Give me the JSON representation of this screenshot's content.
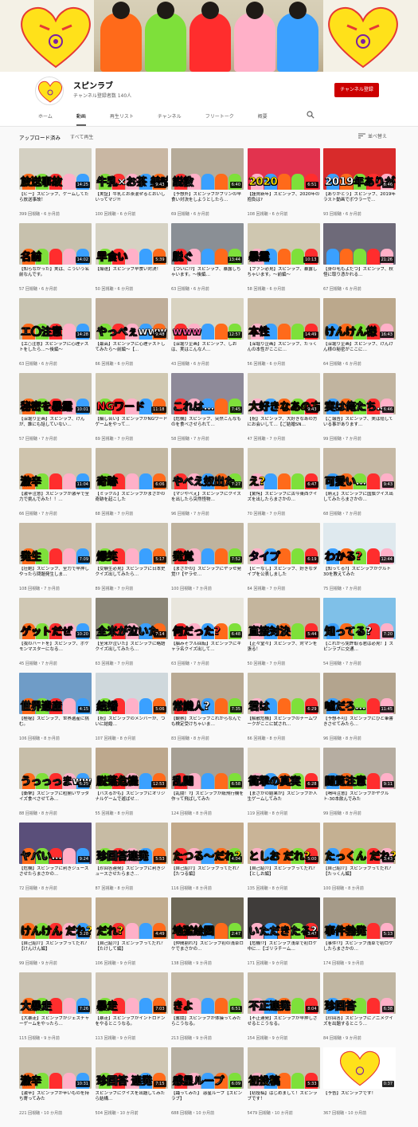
{
  "channel": {
    "name": "スピンラブ",
    "subscribers": "チャンネル登録者数 140人",
    "subscribe_label": "チャンネル登録"
  },
  "tabs": [
    {
      "label": "ホーム"
    },
    {
      "label": "動画"
    },
    {
      "label": "再生リスト"
    },
    {
      "label": "チャンネル"
    },
    {
      "label": "フリートーク"
    },
    {
      "label": "概要"
    }
  ],
  "filter": {
    "label": "アップロード済み",
    "play_all": "すべて再生",
    "sort": "並べ替え"
  },
  "colors": {
    "accent": "#cc0000",
    "heart": "#ffe11a"
  },
  "videos": [
    {
      "cap": "放送事故",
      "capcolor": "#ffd200",
      "bg": "#d4d0c2",
      "dur": "14:25",
      "title": "【ビー】スピンラブ、ゲームしてたら放送事故！",
      "meta": "399 回視聴・6 か月前"
    },
    {
      "cap": "牛乳×お茶 美味しいの?",
      "capcolor": "#ffffff",
      "bg": "#c9b7a3",
      "dur": "9:43",
      "title": "【実証】牛乳とお茶混ぜるとおいしいってマジ?!",
      "meta": "100 回視聴・6 か月前"
    },
    {
      "cap": "説教",
      "capcolor": "#ffffff",
      "bg": "#b6ab99",
      "dur": "6:40",
      "title": "【予想外】スピンラブがプリンの早食い対決をしようとしたら…",
      "meta": "69 回視聴・6 か月前"
    },
    {
      "cap": "2020",
      "capcolor": "#ffe600",
      "bg": "#e2334e",
      "dur": "6:51",
      "title": "【謹賀新年】スピンラブ、2020年の抱負は?",
      "meta": "108 回視聴・6 か月前"
    },
    {
      "cap": "2019年ありがとう",
      "capcolor": "#ffffff",
      "bg": "#d82b2b",
      "dur": "6:46",
      "title": "【ありがとう】スピンラブ、2019年ラスト動画でボウラーで…",
      "meta": "93 回視聴・6 か月前"
    },
    {
      "cap": "名前",
      "capcolor": "#ff2222",
      "bg": "#c7c1ad",
      "dur": "14:02",
      "title": "【知らなかった】実は、こういう名前なんです。",
      "meta": "57 回視聴・6 か月前"
    },
    {
      "cap": "早食い",
      "capcolor": "#ff2222",
      "bg": "#d6d2c3",
      "dur": "5:39",
      "title": "【爆速】スピンラブ早食い対決！",
      "meta": "50 回視聴・6 か月前"
    },
    {
      "cap": "脱ぐ",
      "capcolor": "#ffffff",
      "bg": "#8a8f95",
      "dur": "13:44",
      "title": "【ついに!?】スピンラブ、暴露しちゃいます。〜後編…",
      "meta": "63 回視聴・6 か月前"
    },
    {
      "cap": "暴露",
      "capcolor": "#ff2222",
      "bg": "#cfc7b0",
      "dur": "10:13",
      "title": "【ファン必見】スピンラブ、暴露しちゃいます。〜前編〜",
      "meta": "58 回視聴・6 か月前"
    },
    {
      "cap": "",
      "capcolor": "#ffffff",
      "bg": "#6e6a79",
      "dur": "21:26",
      "title": "【身の毛もよだつ】スピンラブ、秋怪に取り憑かれる…",
      "meta": "67 回視聴・6 か月前"
    },
    {
      "cap": "エ〇注意",
      "capcolor": "#ffffff",
      "bg": "#c8c3b0",
      "dur": "14:28",
      "title": "【エ○注意】スピンラブに心理テストをしたら…〜後編〜",
      "meta": "63 回視聴・6 か月前"
    },
    {
      "cap": "やっぺぇwww",
      "capcolor": "#ffffff",
      "bg": "#bfae9a",
      "dur": "9:48",
      "title": "【最高】スピンラブに心理テストしてみたら〜前編〜【…",
      "meta": "66 回視聴・6 か月前"
    },
    {
      "cap": "www",
      "capcolor": "#ff5ea8",
      "bg": "#d9d3c1",
      "dur": "12:57",
      "title": "【深堀り企画】スピンラブ、しおは、実はこんな人…",
      "meta": "43 回視聴・6 か月前"
    },
    {
      "cap": "本性",
      "capcolor": "#ff2222",
      "bg": "#c7b8a0",
      "dur": "14:49",
      "title": "【深堀り企画】スピンラブ、たっくんの本性がここに…",
      "meta": "56 回視聴・6 か月前"
    },
    {
      "cap": "けんけん様",
      "capcolor": "#ffd200",
      "bg": "#bba88c",
      "dur": "16:43",
      "title": "【深堀り企画】スピンラブ、けんけん様の秘密がここに…",
      "meta": "64 回視聴・6 か月前"
    },
    {
      "cap": "秘密を暴露",
      "capcolor": "#ff2222",
      "bg": "#c9c2af",
      "dur": "10:01",
      "title": "【深堀り企画】スピンラブ、けんが、誰にも話していない…",
      "meta": "57 回視聴・7 か月前"
    },
    {
      "cap": "NGワード",
      "capcolor": "#ff2222",
      "bg": "#d0c8b1",
      "dur": "11:18",
      "title": "【騙し合い】スピンラブがNGワードゲームをやって…",
      "meta": "69 回視聴・7 か月前"
    },
    {
      "cap": "これは…",
      "capcolor": "#ffffff",
      "bg": "#8e8a99",
      "dur": "7:45",
      "title": "【危機】スピンラブ、突然こんなものを食べさせられて…",
      "meta": "58 回視聴・7 か月前"
    },
    {
      "cap": "大好きなあの方",
      "capcolor": "#ffd200",
      "bg": "#d6cfbd",
      "dur": "9:43",
      "title": "【祝】スピンラブ、大好きなあの方にお会いして…【ご結婚SN…",
      "meta": "47 回視聴・7 か月前"
    },
    {
      "cap": "実は俺たち…",
      "capcolor": "#ffffff",
      "bg": "#c1b49f",
      "dur": "6:46",
      "title": "【ご報告】スピンラブ、実は隠している事があります…",
      "meta": "99 回視聴・7 か月前"
    },
    {
      "cap": "激辛",
      "capcolor": "#ffd200",
      "bg": "#cfc4ad",
      "dur": "11:04",
      "title": "【激辛注意】スピンラブが激辛で全力で挑んでみた！！…",
      "meta": "66 回視聴・7 か月前"
    },
    {
      "cap": "奇跡",
      "capcolor": "#ffd200",
      "bg": "#c4b9a3",
      "dur": "6:06",
      "title": "【ミラクル】スピンラブがまさかの奇跡を起こした",
      "meta": "68 回視聴・7 か月前"
    },
    {
      "cap": "やべえ奴出た",
      "capcolor": "#ffffff",
      "bg": "#b7ac98",
      "dur": "7:27",
      "title": "【マジやべえ】スピンラブにクイズを出したら突然怪物…",
      "meta": "96 回視聴・7 か月前"
    },
    {
      "cap": "え?",
      "capcolor": "#ffd200",
      "bg": "#d3ccb9",
      "dur": "6:47",
      "title": "【驚愕】スピンラブに古今東西クイズを出したらまさかの…",
      "meta": "70 回視聴・7 か月前"
    },
    {
      "cap": "可愛い…",
      "capcolor": "#ffffff",
      "bg": "#c6b9a5",
      "dur": "9:43",
      "title": "【萌え】スピンラブに国旗クイズ出してみたらまさかの…",
      "meta": "68 回視聴・7 か月前"
    },
    {
      "cap": "発生",
      "capcolor": "#ffd200",
      "bg": "#c9bda8",
      "dur": "7:09",
      "title": "【壮絶】スピンラブ、全力で早押しやったら問題発生しま…",
      "meta": "108 回視聴・7 か月前"
    },
    {
      "cap": "爆笑",
      "capcolor": "#ffd200",
      "bg": "#cbc3b0",
      "dur": "5:17",
      "title": "【受験生必見】スピンラブに日本史クイズ出してみたら…",
      "meta": "89 回視聴・7 か月前"
    },
    {
      "cap": "発覚",
      "capcolor": "#ffd200",
      "bg": "#bfb39e",
      "dur": "7:52",
      "title": "【まさかの】スピンラブにヤラセ発覚!?【ヤラセ…",
      "meta": "100 回視聴・7 か月前"
    },
    {
      "cap": "タイプ",
      "capcolor": "#a855f7",
      "bg": "#d2cab7",
      "dur": "6:19",
      "title": "【ビーなし】スピンラブ、好きなタイプを公表しました",
      "meta": "64 回視聴・7 か月前"
    },
    {
      "cap": "わかる?",
      "capcolor": "#ff2222",
      "bg": "#dfe9ee",
      "dur": "12:44",
      "title": "【知ってる?】スピンラブがクルト30を教えてみた",
      "meta": "75 回視聴・7 か月前"
    },
    {
      "cap": "ゲットだぜ",
      "capcolor": "#ff2222",
      "bg": "#d0c8b4",
      "dur": "10:20",
      "title": "【我のハートを】スピンラブ、ポケモンマスターになる…",
      "meta": "45 回視聴・7 か月前"
    },
    {
      "cap": "全米が泣いた",
      "capcolor": "#ffffff",
      "bg": "#8b8677",
      "dur": "7:14",
      "title": "【全米が泣いた】スピンラブに略語クイズ出してみたら…",
      "meta": "63 回視聴・7 か月前"
    },
    {
      "cap": "何だった?",
      "capcolor": "#ff2222",
      "bg": "#e9e6dd",
      "dur": "6:48",
      "title": "【脳みそフル回転】スピンラブにキャラ名クイズ出して…",
      "meta": "63 回視聴・7 か月前"
    },
    {
      "cap": "直接対決",
      "capcolor": "#ffffff",
      "bg": "#c4b59d",
      "dur": "5:44",
      "title": "【正々堂々】スピンラブ、対マンを張る！",
      "meta": "50 回視聴・7 か月前"
    },
    {
      "cap": "知ってる?",
      "capcolor": "#ffffff",
      "bg": "#7fc0e8",
      "dur": "7:20",
      "title": "【これから免許取る君は必見！】スピンラブに交通…",
      "meta": "54 回視聴・7 か月前"
    },
    {
      "cap": "世界遺産",
      "capcolor": "#ffffff",
      "bg": "#6f9cc7",
      "dur": "4:15",
      "title": "【極秘】スピンラブ、世界遺産に挑む。",
      "meta": "106 回視聴・8 か月前"
    },
    {
      "cap": "結婚",
      "capcolor": "#ffffff",
      "bg": "#cfd8dc",
      "dur": "5:06",
      "title": "【祝】スピンラブのメンバーが、ついに結婚…",
      "meta": "107 回視聴・8 か月前"
    },
    {
      "cap": "常識人?",
      "capcolor": "#ffffff",
      "bg": "#b9aa94",
      "dur": "7:35",
      "title": "【観察】スピンラブこれからなんでも検定受けちゃいま…",
      "meta": "83 回視聴・8 か月前"
    },
    {
      "cap": "君は",
      "capcolor": "#ffffff",
      "bg": "#c9c0ab",
      "dur": "6:29",
      "title": "【解散危機】スピンラブのチームワークがここに試され…",
      "meta": "66 回視聴・8 か月前"
    },
    {
      "cap": "嘘だろ…",
      "capcolor": "#ffffff",
      "bg": "#b3a48e",
      "dur": "11:45",
      "title": "【予想不可】スピンラブにひと筆書きさせてみたら…",
      "meta": "96 回視聴・8 か月前"
    },
    {
      "cap": "うっっっまwww",
      "capcolor": "#ffffff",
      "bg": "#c7bea9",
      "dur": "6:25",
      "title": "【衝撃】スピンラブに粒揃いサラダイズ食べさせてみ…",
      "meta": "88 回視聴・8 か月前"
    },
    {
      "cap": "脱落危機",
      "capcolor": "#ffd200",
      "bg": "#bda88d",
      "dur": "12:53",
      "title": "【バズるかも】スピンラブにオリジナルゲームで遊ばせ…",
      "meta": "55 回視聴・8 か月前"
    },
    {
      "cap": "乱闘",
      "capcolor": "#ffffff",
      "bg": "#a7a094",
      "dur": "6:58",
      "title": "【乱闘！?】スピンラブが紙飛行機を作って飛ばしてみた",
      "meta": "124 回視聴・8 か月前"
    },
    {
      "cap": "衝撃の真実",
      "capcolor": "#ffffff",
      "bg": "#ddd6c6",
      "dur": "6:28",
      "title": "【まさかの結果が】スピンラブが人生ゲームしてみた",
      "meta": "119 回視聴・8 か月前"
    },
    {
      "cap": "閲覧注意",
      "capcolor": "#ffffff",
      "bg": "#b6ada1",
      "dur": "9:11",
      "title": "【喝叫注意】スピンラブがヤクルト-30本飲んでみた",
      "meta": "99 回視聴・8 か月前"
    },
    {
      "cap": "ヤバい…",
      "capcolor": "#ffffff",
      "bg": "#5a4f7a",
      "dur": "9:24",
      "title": "【危機】スピンラブに利きジュースさせたらまさかの…",
      "meta": "72 回視聴・8 か月前"
    },
    {
      "cap": "珍回答連発",
      "capcolor": "#ffffff",
      "bg": "#c7bba4",
      "dur": "5:53",
      "title": "【珍回答連発】スピンラブに利きジュースさせたらまさ…",
      "meta": "87 回視聴・8 か月前"
    },
    {
      "cap": "たつる〜だれ?",
      "capcolor": "#ffd200",
      "bg": "#c2a98a",
      "dur": "4:04",
      "title": "【自己紹介】スピンラブってだれ？【たつる編】",
      "meta": "116 回視聴・8 か月前"
    },
    {
      "cap": "としお だれ?",
      "capcolor": "#ffd200",
      "bg": "#c9b497",
      "dur": "5:00",
      "title": "【自己紹介】スピンラブってだれ？【としお編】",
      "meta": "135 回視聴・8 か月前"
    },
    {
      "cap": "たっくん だれ?",
      "capcolor": "#ffd200",
      "bg": "#c4b092",
      "dur": "3:43",
      "title": "【自己紹介】スピンラブってだれ？【たっくん編】",
      "meta": "100 回視聴・8 か月前"
    },
    {
      "cap": "けんけん だれ?",
      "capcolor": "#ffd200",
      "bg": "#c8b294",
      "dur": "3:28",
      "title": "【自己紹介】スピンラブってだれ？【けんけん編】",
      "meta": "99 回視聴・9 か月前"
    },
    {
      "cap": "だれ?",
      "capcolor": "#ffd200",
      "bg": "#c1ac8e",
      "dur": "4:49",
      "title": "【自己紹介】スピンラブってだれ？【たけして編】",
      "meta": "106 回視聴・9 か月前"
    },
    {
      "cap": "地獄絵図",
      "capcolor": "#ffd200",
      "bg": "#6e6857",
      "dur": "2:47",
      "title": "【仲間割れ?】スピンラブ初の浅草ロケでまさかの…",
      "meta": "138 回視聴・9 か月前"
    },
    {
      "cap": "いただきたる?",
      "capcolor": "#ffffff",
      "bg": "#3f3c3a",
      "dur": "3:47",
      "title": "【危機!?】スピンラブ浅草で初ロケ中に…【ゴリラチーム…",
      "meta": "171 回視聴・9 か月前"
    },
    {
      "cap": "事件勃発",
      "capcolor": "#ffd200",
      "bg": "#a59a88",
      "dur": "5:13",
      "title": "【事件!?】スピンラブ浅草で初ロケしたらまさかの…",
      "meta": "174 回視聴・9 か月前"
    },
    {
      "cap": "大暴走",
      "capcolor": "#ffffff",
      "bg": "#c9c1b0",
      "dur": "7:26",
      "title": "【大暴走】スピンラブがジェスチャーゲームをやったら…",
      "meta": "115 回視聴・9 か月前"
    },
    {
      "cap": "暴走",
      "capcolor": "#ffd200",
      "bg": "#d0c6b6",
      "dur": "7:03",
      "title": "【暴走】スピンラブがイントロドンをやるとこうなる。",
      "meta": "113 回視聴・9 か月前"
    },
    {
      "cap": "きよ",
      "capcolor": "#ffd200",
      "bg": "#c4b9a6",
      "dur": "6:51",
      "title": "【奮闘】スピンラブが体操ってみたらこうなる。",
      "meta": "213 回視聴・9 か月前"
    },
    {
      "cap": "不正連発",
      "capcolor": "#ffffff",
      "bg": "#c6bca9",
      "dur": "8:04",
      "title": "【不正連発】スピンラブが早押しさせるとこうなる。",
      "meta": "154 回視聴・9 か月前"
    },
    {
      "cap": "珍回答",
      "capcolor": "#ffffff",
      "bg": "#c0b6a2",
      "dur": "6:38",
      "title": "【珍回答】スピンラブにアニメクイズを出題するとこう…",
      "meta": "84 回視聴・9 か月前"
    },
    {
      "cap": "激辛",
      "capcolor": "#ffd200",
      "bg": "#c7bda9",
      "dur": "10:31",
      "title": "【激辛】スピンラブが辛いものを持ち寄ってみた",
      "meta": "221 回視聴・10 か月前"
    },
    {
      "cap": "珍回答 連発",
      "capcolor": "#ffffff",
      "bg": "#cfc6b3",
      "dur": "7:15",
      "title": "スピンラブにクイズを出題してみたら結構…",
      "meta": "504 回視聴・10 か月前"
    },
    {
      "cap": "感星ループ",
      "capcolor": "#ffffff",
      "bg": "#b9b2a4",
      "dur": "6:09",
      "title": "【踊ってみた】 惑星ループ【スピンラブ】",
      "meta": "688 回視聴・10 か月前"
    },
    {
      "cap": "初投稿",
      "capcolor": "#ffd200",
      "bg": "#c9c0ad",
      "dur": "5:33",
      "title": "【初投稿】はじめまして！スピンラブです！",
      "meta": "5479 回視聴・10 か月前"
    },
    {
      "cap": "",
      "capcolor": "#ffffff",
      "bg": "#ffffff",
      "dur": "0:37",
      "title": "【予告】スピンラブです！",
      "meta": "367 回視聴・10 か月前",
      "heart": true
    }
  ]
}
